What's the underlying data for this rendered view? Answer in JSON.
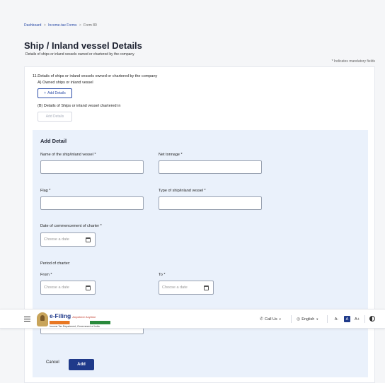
{
  "breadcrumb": {
    "item1": "Dashboard",
    "item2": "Income-tax Forms",
    "item3": "Form 80",
    "sep": ">"
  },
  "page": {
    "title": "Ship / Inland vessel Details",
    "subtitle": "Details of ships or inland vessels owned or chartered by the company",
    "mandatory_note": "* Indicates mandatory fields"
  },
  "question": {
    "text": "11.Details of ships or inland vessels owned or chartered by the company",
    "part_a": "A) Owned ships or inland vessel",
    "part_a_button": "Add Details",
    "part_b": "(B) Details of Ships or inland vessel chartered in",
    "part_b_button": "Add Details"
  },
  "add_detail": {
    "title": "Add Detail",
    "name_label": "Name of the ship/inland vessel *",
    "tonnage_label": "Net tonnage *",
    "flag_label": "Flag *",
    "type_label": "Type of ship/inland vessel *",
    "charter_date_label": "Date of commencement of charter *",
    "date_placeholder": "Choose a date",
    "period_label": "Period of charter:",
    "from_label": "From *",
    "to_label": "To *",
    "cancel": "Cancel",
    "add": "Add"
  },
  "header": {
    "logo_main": "e-Filing",
    "logo_tag": "Anywhere Anytime",
    "logo_sub": "Income Tax Department, Government of India",
    "call_us": "Call Us",
    "language": "English",
    "font_small": "A-",
    "font_normal": "A",
    "font_large": "A+"
  },
  "colors": {
    "primary": "#1f3a8a",
    "link": "#2b4ca8",
    "panel": "#eaf1fb"
  }
}
